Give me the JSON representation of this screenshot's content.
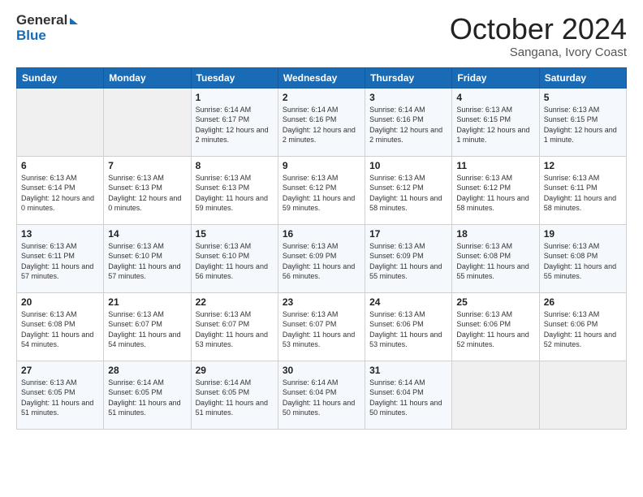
{
  "header": {
    "logo_general": "General",
    "logo_blue": "Blue",
    "month_title": "October 2024",
    "location": "Sangana, Ivory Coast"
  },
  "weekdays": [
    "Sunday",
    "Monday",
    "Tuesday",
    "Wednesday",
    "Thursday",
    "Friday",
    "Saturday"
  ],
  "weeks": [
    [
      {
        "day": "",
        "info": ""
      },
      {
        "day": "",
        "info": ""
      },
      {
        "day": "1",
        "info": "Sunrise: 6:14 AM\nSunset: 6:17 PM\nDaylight: 12 hours and 2 minutes."
      },
      {
        "day": "2",
        "info": "Sunrise: 6:14 AM\nSunset: 6:16 PM\nDaylight: 12 hours and 2 minutes."
      },
      {
        "day": "3",
        "info": "Sunrise: 6:14 AM\nSunset: 6:16 PM\nDaylight: 12 hours and 2 minutes."
      },
      {
        "day": "4",
        "info": "Sunrise: 6:13 AM\nSunset: 6:15 PM\nDaylight: 12 hours and 1 minute."
      },
      {
        "day": "5",
        "info": "Sunrise: 6:13 AM\nSunset: 6:15 PM\nDaylight: 12 hours and 1 minute."
      }
    ],
    [
      {
        "day": "6",
        "info": "Sunrise: 6:13 AM\nSunset: 6:14 PM\nDaylight: 12 hours and 0 minutes."
      },
      {
        "day": "7",
        "info": "Sunrise: 6:13 AM\nSunset: 6:13 PM\nDaylight: 12 hours and 0 minutes."
      },
      {
        "day": "8",
        "info": "Sunrise: 6:13 AM\nSunset: 6:13 PM\nDaylight: 11 hours and 59 minutes."
      },
      {
        "day": "9",
        "info": "Sunrise: 6:13 AM\nSunset: 6:12 PM\nDaylight: 11 hours and 59 minutes."
      },
      {
        "day": "10",
        "info": "Sunrise: 6:13 AM\nSunset: 6:12 PM\nDaylight: 11 hours and 58 minutes."
      },
      {
        "day": "11",
        "info": "Sunrise: 6:13 AM\nSunset: 6:12 PM\nDaylight: 11 hours and 58 minutes."
      },
      {
        "day": "12",
        "info": "Sunrise: 6:13 AM\nSunset: 6:11 PM\nDaylight: 11 hours and 58 minutes."
      }
    ],
    [
      {
        "day": "13",
        "info": "Sunrise: 6:13 AM\nSunset: 6:11 PM\nDaylight: 11 hours and 57 minutes."
      },
      {
        "day": "14",
        "info": "Sunrise: 6:13 AM\nSunset: 6:10 PM\nDaylight: 11 hours and 57 minutes."
      },
      {
        "day": "15",
        "info": "Sunrise: 6:13 AM\nSunset: 6:10 PM\nDaylight: 11 hours and 56 minutes."
      },
      {
        "day": "16",
        "info": "Sunrise: 6:13 AM\nSunset: 6:09 PM\nDaylight: 11 hours and 56 minutes."
      },
      {
        "day": "17",
        "info": "Sunrise: 6:13 AM\nSunset: 6:09 PM\nDaylight: 11 hours and 55 minutes."
      },
      {
        "day": "18",
        "info": "Sunrise: 6:13 AM\nSunset: 6:08 PM\nDaylight: 11 hours and 55 minutes."
      },
      {
        "day": "19",
        "info": "Sunrise: 6:13 AM\nSunset: 6:08 PM\nDaylight: 11 hours and 55 minutes."
      }
    ],
    [
      {
        "day": "20",
        "info": "Sunrise: 6:13 AM\nSunset: 6:08 PM\nDaylight: 11 hours and 54 minutes."
      },
      {
        "day": "21",
        "info": "Sunrise: 6:13 AM\nSunset: 6:07 PM\nDaylight: 11 hours and 54 minutes."
      },
      {
        "day": "22",
        "info": "Sunrise: 6:13 AM\nSunset: 6:07 PM\nDaylight: 11 hours and 53 minutes."
      },
      {
        "day": "23",
        "info": "Sunrise: 6:13 AM\nSunset: 6:07 PM\nDaylight: 11 hours and 53 minutes."
      },
      {
        "day": "24",
        "info": "Sunrise: 6:13 AM\nSunset: 6:06 PM\nDaylight: 11 hours and 53 minutes."
      },
      {
        "day": "25",
        "info": "Sunrise: 6:13 AM\nSunset: 6:06 PM\nDaylight: 11 hours and 52 minutes."
      },
      {
        "day": "26",
        "info": "Sunrise: 6:13 AM\nSunset: 6:06 PM\nDaylight: 11 hours and 52 minutes."
      }
    ],
    [
      {
        "day": "27",
        "info": "Sunrise: 6:13 AM\nSunset: 6:05 PM\nDaylight: 11 hours and 51 minutes."
      },
      {
        "day": "28",
        "info": "Sunrise: 6:14 AM\nSunset: 6:05 PM\nDaylight: 11 hours and 51 minutes."
      },
      {
        "day": "29",
        "info": "Sunrise: 6:14 AM\nSunset: 6:05 PM\nDaylight: 11 hours and 51 minutes."
      },
      {
        "day": "30",
        "info": "Sunrise: 6:14 AM\nSunset: 6:04 PM\nDaylight: 11 hours and 50 minutes."
      },
      {
        "day": "31",
        "info": "Sunrise: 6:14 AM\nSunset: 6:04 PM\nDaylight: 11 hours and 50 minutes."
      },
      {
        "day": "",
        "info": ""
      },
      {
        "day": "",
        "info": ""
      }
    ]
  ]
}
